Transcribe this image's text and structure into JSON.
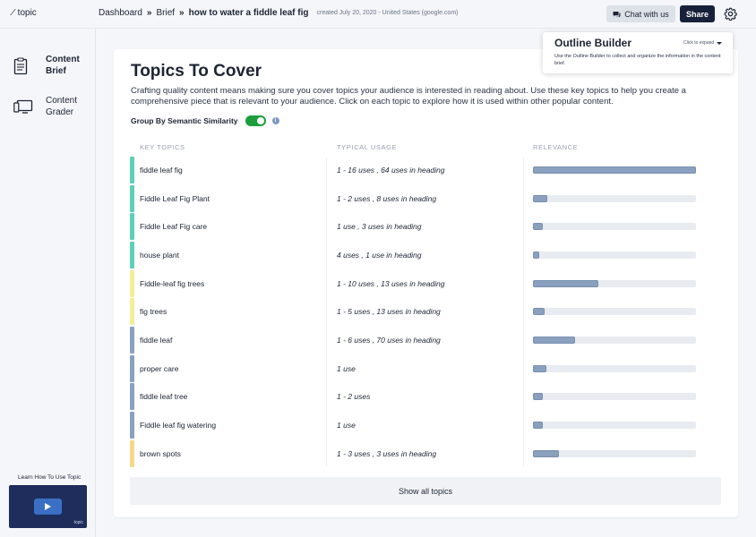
{
  "topbar": {
    "logo_text": "topic",
    "breadcrumbs": [
      "Dashboard",
      "Brief"
    ],
    "separator": "»",
    "current_page": "how to water a fiddle leaf fig",
    "meta": "created July 20, 2020 - United States (google.com)",
    "chat_label": "Chat with us",
    "share_label": "Share"
  },
  "sidebar": {
    "items": [
      {
        "label_line1": "Content",
        "label_line2": "Brief",
        "icon": "clipboard-icon",
        "active": true
      },
      {
        "label_line1": "Content",
        "label_line2": "Grader",
        "icon": "monitor-icon",
        "active": false
      }
    ],
    "learn_label": "Learn How To Use Topic",
    "video_brand": "topic"
  },
  "main": {
    "title": "Topics To Cover",
    "intro": "Crafting quality content means making sure you cover topics your audience is interested in reading about. Use these key topics to help you create a comprehensive piece that is relevant to your audience. Click on each topic to explore how it is used within other popular content.",
    "group_label": "Group By Semantic Similarity",
    "group_enabled": true,
    "columns": [
      "KEY TOPICS",
      "TYPICAL USAGE",
      "RELEVANCE"
    ],
    "show_all_label": "Show all topics",
    "topics": [
      {
        "topic": "fiddle leaf fig",
        "usage": "1 - 16 uses , 64 uses in heading",
        "relevance": 1.0,
        "accent": "#5fcfb5"
      },
      {
        "topic": "Fiddle Leaf Fig Plant",
        "usage": "1 - 2 uses , 8 uses in heading",
        "relevance": 0.09,
        "accent": "#5fcfb5"
      },
      {
        "topic": "Fiddle Leaf Fig care",
        "usage": "1 use , 3 uses in heading",
        "relevance": 0.06,
        "accent": "#5fcfb5"
      },
      {
        "topic": "house plant",
        "usage": "4 uses , 1 use in heading",
        "relevance": 0.04,
        "accent": "#5fcfb5"
      },
      {
        "topic": "Fiddle-leaf fig trees",
        "usage": "1 - 10 uses , 13 uses in heading",
        "relevance": 0.4,
        "accent": "#f2ef98"
      },
      {
        "topic": "fig trees",
        "usage": "1 - 5 uses , 13 uses in heading",
        "relevance": 0.07,
        "accent": "#f2ef98"
      },
      {
        "topic": "fiddle leaf",
        "usage": "1 - 6 uses , 70 uses in heading",
        "relevance": 0.26,
        "accent": "#8aa0bf"
      },
      {
        "topic": "proper care",
        "usage": "1 use",
        "relevance": 0.08,
        "accent": "#8aa0bf"
      },
      {
        "topic": "fiddle leaf tree",
        "usage": "1 - 2 uses",
        "relevance": 0.06,
        "accent": "#8aa0bf"
      },
      {
        "topic": "Fiddle leaf fig watering",
        "usage": "1 use",
        "relevance": 0.06,
        "accent": "#8aa0bf"
      },
      {
        "topic": "brown spots",
        "usage": "1 - 3 uses , 3 uses in heading",
        "relevance": 0.16,
        "accent": "#f5d88a"
      }
    ]
  },
  "outline": {
    "title": "Outline Builder",
    "expand_label": "Click to expand",
    "description": "Use the Outline Builder to collect and organize the information in the content brief."
  }
}
